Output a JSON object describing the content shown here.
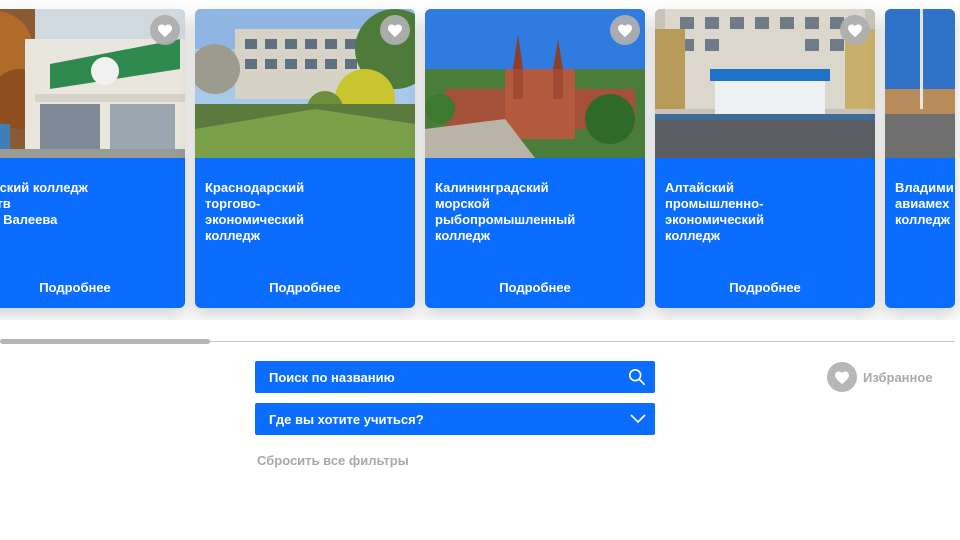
{
  "cards": [
    {
      "title": "Байский колледж\nусств\nК.А. Валеева",
      "more": "Подробнее",
      "photo": "college-building-photo"
    },
    {
      "title": "Краснодарский\nторгово-\nэкономический\nколледж",
      "more": "Подробнее",
      "photo": "college-building-photo"
    },
    {
      "title": "Калининградский\nморской\nрыбопромышленный\nколледж",
      "more": "Подробнее",
      "photo": "cathedral-photo"
    },
    {
      "title": "Алтайский\nпромышленно-\nэкономический\nколледж",
      "more": "Подробнее",
      "photo": "college-building-photo"
    },
    {
      "title": "Владими\nавиамех\nколледж",
      "more": "",
      "photo": "city-street-photo"
    }
  ],
  "favorite_icon": "heart-icon",
  "search": {
    "label": "Поиск по названию",
    "icon": "search-icon"
  },
  "region_select": {
    "label": "Где вы хотите учиться?",
    "icon": "chevron-down-icon"
  },
  "reset_label": "Сбросить все фильтры",
  "favorites": {
    "label": "Избранное",
    "icon": "heart-icon"
  },
  "colors": {
    "accent": "#0a6dff",
    "muted": "#a9a9a9",
    "icon_gray": "#b7b7b7"
  }
}
